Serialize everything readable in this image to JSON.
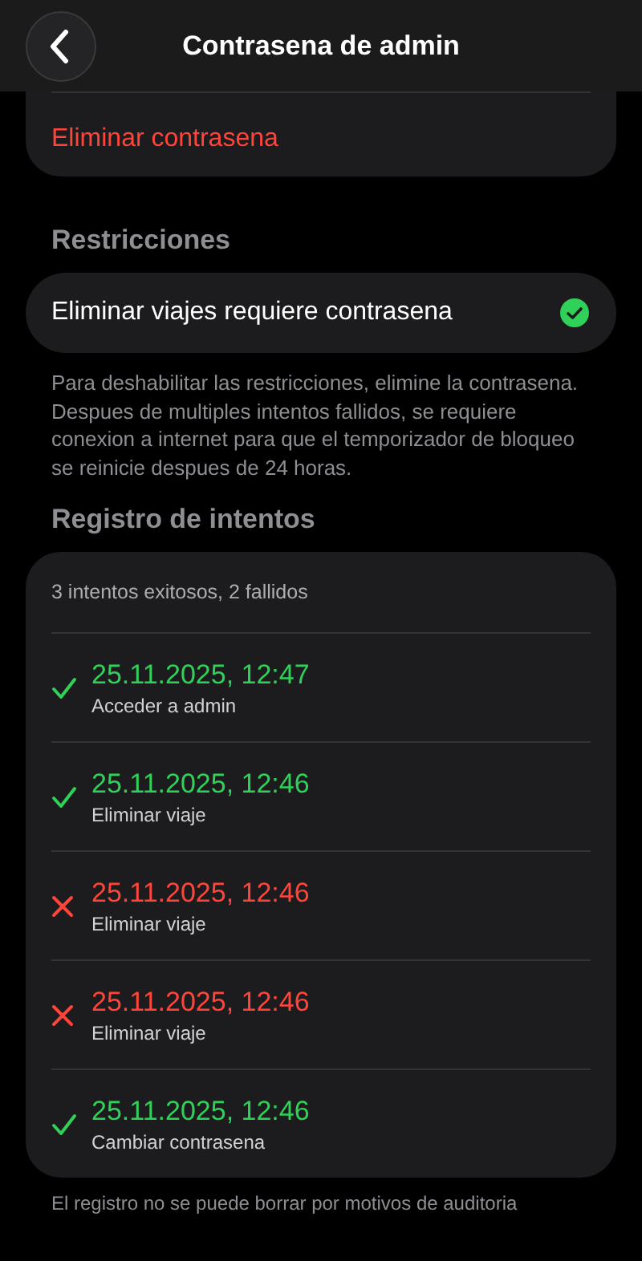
{
  "header": {
    "title": "Contrasena de admin"
  },
  "password_card": {
    "action": "Eliminar contrasena"
  },
  "restrictions": {
    "title": "Restricciones",
    "items": [
      {
        "label": "Eliminar viajes requiere contrasena",
        "checked": true
      }
    ],
    "notes": [
      "Para deshabilitar las restricciones, elimine la contrasena.",
      "Despues de multiples intentos fallidos, se requiere conexion a internet para que el temporizador de bloqueo se reinicie despues de 24 horas."
    ]
  },
  "log": {
    "title": "Registro de intentos",
    "summary": "3 intentos exitosos, 2 fallidos",
    "entries": [
      {
        "kind": "success",
        "time": "25.11.2025, 12:47",
        "action": "Acceder a admin"
      },
      {
        "kind": "success",
        "time": "25.11.2025, 12:46",
        "action": "Eliminar viaje"
      },
      {
        "kind": "failure",
        "time": "25.11.2025, 12:46",
        "action": "Eliminar viaje"
      },
      {
        "kind": "failure",
        "time": "25.11.2025, 12:46",
        "action": "Eliminar viaje"
      },
      {
        "kind": "success",
        "time": "25.11.2025, 12:46",
        "action": "Cambiar contrasena"
      }
    ],
    "footer": "El registro no se puede borrar por motivos de auditoria"
  }
}
